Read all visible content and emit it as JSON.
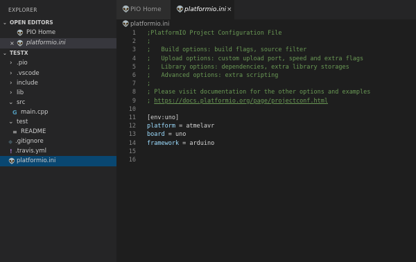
{
  "sidebar": {
    "title": "EXPLORER",
    "open_editors": {
      "label": "OPEN EDITORS",
      "items": [
        {
          "label": "PIO Home",
          "icon": "platformio-icon"
        },
        {
          "label": "platformio.ini",
          "icon": "platformio-icon",
          "close": "×"
        }
      ]
    },
    "project": {
      "label": "TESTX",
      "items": [
        {
          "label": ".pio",
          "type": "folder"
        },
        {
          "label": ".vscode",
          "type": "folder"
        },
        {
          "label": "include",
          "type": "folder"
        },
        {
          "label": "lib",
          "type": "folder"
        },
        {
          "label": "src",
          "type": "folder-open"
        },
        {
          "label": "main.cpp",
          "type": "file-cpp"
        },
        {
          "label": "test",
          "type": "folder-open"
        },
        {
          "label": "README",
          "type": "file-readme"
        },
        {
          "label": ".gitignore",
          "type": "file-git"
        },
        {
          "label": ".travis.yml",
          "type": "file-yml"
        },
        {
          "label": "platformio.ini",
          "type": "file-pio"
        }
      ]
    }
  },
  "tabs": [
    {
      "label": "PIO Home",
      "active": false
    },
    {
      "label": "platformio.ini",
      "active": true,
      "close": "×"
    }
  ],
  "breadcrumb": {
    "label": "platformio.ini"
  },
  "editor": {
    "line_numbers": [
      "1",
      "2",
      "3",
      "4",
      "5",
      "6",
      "7",
      "8",
      "9",
      "10",
      "11",
      "12",
      "13",
      "14",
      "15",
      "16"
    ],
    "lines": [
      ";PlatformIO Project Configuration File",
      ";",
      ";   Build options: build flags, source filter",
      ";   Upload options: custom upload port, speed and extra flags",
      ";   Library options: dependencies, extra library storages",
      ";   Advanced options: extra scripting",
      ";",
      "; Please visit documentation for the other options and examples",
      "; ",
      "",
      "[env:uno]",
      "",
      "",
      "",
      "",
      ""
    ],
    "line9_link": "https://docs.platformio.org/page/projectconf.html",
    "kv": [
      {
        "key": "platform",
        "sep": " = ",
        "value": "atmelavr"
      },
      {
        "key": "board",
        "sep": " = ",
        "value": "uno"
      },
      {
        "key": "framework",
        "sep": " = ",
        "value": "arduino"
      }
    ]
  },
  "colors": {
    "accent_selection": "#094771",
    "comment": "#6a9955",
    "key": "#9cdcfe",
    "platformio_orange": "#f5871f"
  }
}
